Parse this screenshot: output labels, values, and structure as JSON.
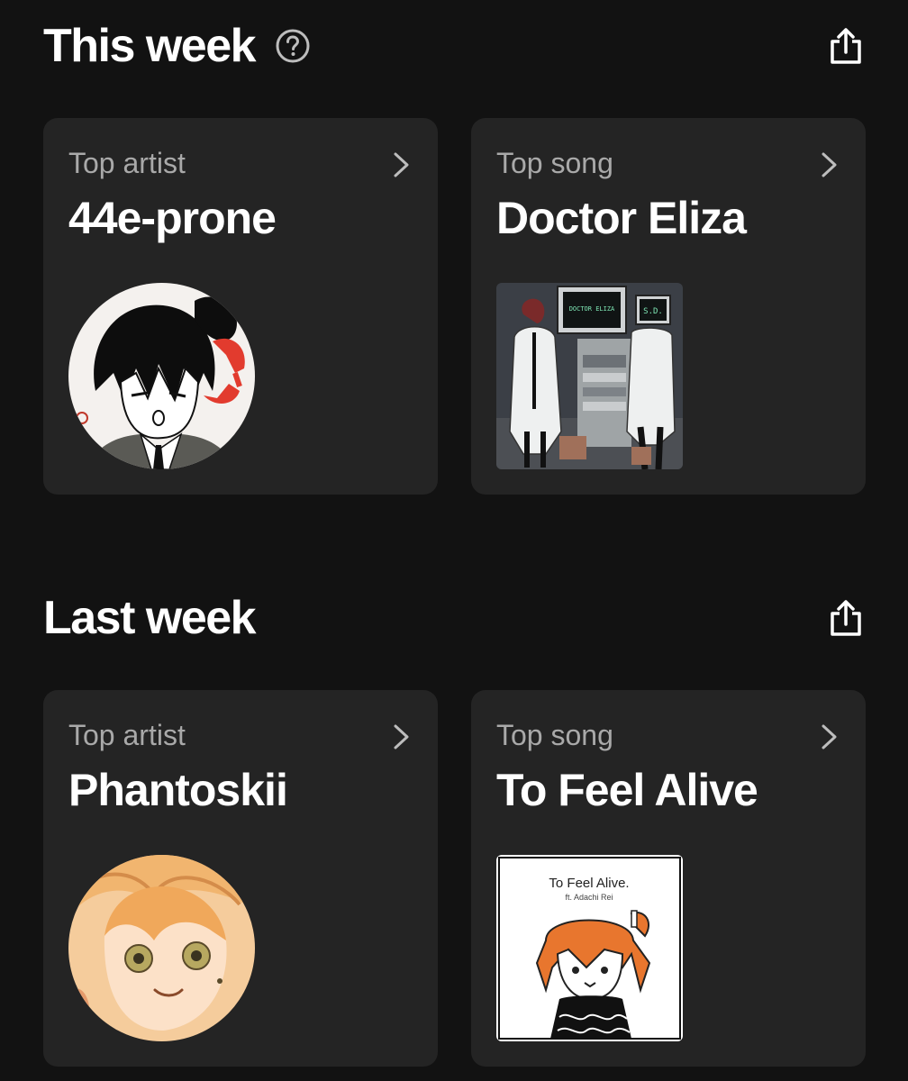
{
  "this_week": {
    "title": "This week",
    "top_artist": {
      "label": "Top artist",
      "name": "44e-prone"
    },
    "top_song": {
      "label": "Top song",
      "name": "Doctor Eliza",
      "cover_text": [
        "DOCTOR ELIZA",
        "S.D."
      ]
    }
  },
  "last_week": {
    "title": "Last week",
    "top_artist": {
      "label": "Top artist",
      "name": "Phantoskii"
    },
    "top_song": {
      "label": "Top song",
      "name": "To Feel Alive",
      "cover_title": "To Feel Alive.",
      "cover_subtitle": "ft. Adachi Rei"
    }
  },
  "icons": {
    "help": "help-circle-icon",
    "share": "share-icon",
    "chevron": "chevron-right-icon"
  },
  "colors": {
    "background": "#121212",
    "card": "#242424",
    "label": "#a9a9a9",
    "text": "#ffffff"
  }
}
